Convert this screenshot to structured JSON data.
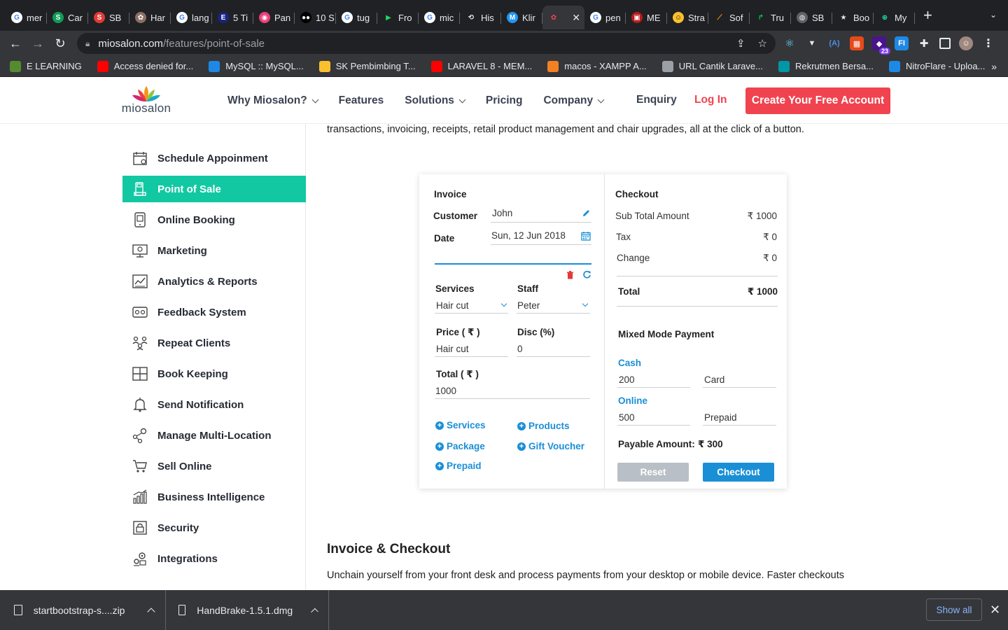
{
  "browser": {
    "tabs": [
      {
        "label": "mer",
        "color": "#ffffff",
        "glyph": "G",
        "fg": "#4285f4"
      },
      {
        "label": "Car",
        "color": "#0f9d58",
        "glyph": "S",
        "fg": "#fff"
      },
      {
        "label": "SB",
        "color": "#e53935",
        "glyph": "S",
        "fg": "#fff"
      },
      {
        "label": "Har",
        "color": "#8d6e63",
        "glyph": "✿",
        "fg": "#fff"
      },
      {
        "label": "lang",
        "color": "#ffffff",
        "glyph": "G",
        "fg": "#4285f4"
      },
      {
        "label": "5 Ti",
        "color": "#1a237e",
        "glyph": "E",
        "fg": "#fff"
      },
      {
        "label": "Pan",
        "color": "#ec407a",
        "glyph": "◉",
        "fg": "#fff"
      },
      {
        "label": "10 S",
        "color": "#000000",
        "glyph": "●●",
        "fg": "#fff"
      },
      {
        "label": "tug",
        "color": "#ffffff",
        "glyph": "G",
        "fg": "#4285f4"
      },
      {
        "label": "Fro",
        "color": "#202124",
        "glyph": "▶",
        "fg": "#1ed760"
      },
      {
        "label": "mic",
        "color": "#ffffff",
        "glyph": "G",
        "fg": "#4285f4"
      },
      {
        "label": "His",
        "color": "#202124",
        "glyph": "⟲",
        "fg": "#e8eaed"
      },
      {
        "label": "Klir",
        "color": "#2196f3",
        "glyph": "M",
        "fg": "#fff"
      },
      {
        "label": "",
        "color": "#35363a",
        "glyph": "✿",
        "fg": "#f0434f",
        "active": true
      },
      {
        "label": "pen",
        "color": "#ffffff",
        "glyph": "G",
        "fg": "#4285f4"
      },
      {
        "label": "ME",
        "color": "#b71c1c",
        "glyph": "▣",
        "fg": "#fff"
      },
      {
        "label": "Stra",
        "color": "#fbc02d",
        "glyph": "☺",
        "fg": "#222"
      },
      {
        "label": "Sof",
        "color": "#202124",
        "glyph": "⟋",
        "fg": "#ff9800"
      },
      {
        "label": "Tru",
        "color": "#202124",
        "glyph": "↱",
        "fg": "#00c853"
      },
      {
        "label": "SB",
        "color": "#5f6368",
        "glyph": "◍",
        "fg": "#e8eaed"
      },
      {
        "label": "Boo",
        "color": "#202124",
        "glyph": "★",
        "fg": "#e8eaed"
      },
      {
        "label": "My",
        "color": "#202124",
        "glyph": "⊕",
        "fg": "#1de9b6"
      }
    ],
    "url_host": "miosalon.com",
    "url_path": "/features/point-of-sale",
    "extension_badge": "23",
    "bookmarks": [
      {
        "label": "E LEARNING",
        "color": "#558b2f"
      },
      {
        "label": "Access denied for...",
        "color": "#ff0000"
      },
      {
        "label": "MySQL :: MySQL...",
        "color": "#1e88e5"
      },
      {
        "label": "SK Pembimbing T...",
        "color": "#fbc02d"
      },
      {
        "label": "LARAVEL 8 - MEM...",
        "color": "#ff0000"
      },
      {
        "label": "macos - XAMPP A...",
        "color": "#f48024"
      },
      {
        "label": "URL Cantik Larave...",
        "color": "#9aa0a6"
      },
      {
        "label": "Rekrutmen Bersa...",
        "color": "#0097a7"
      },
      {
        "label": "NitroFlare - Uploa...",
        "color": "#1e88e5"
      }
    ]
  },
  "header": {
    "logo_text": "miosalon",
    "nav": [
      {
        "label": "Why Miosalon?",
        "dropdown": true
      },
      {
        "label": "Features",
        "dropdown": false
      },
      {
        "label": "Solutions",
        "dropdown": true
      },
      {
        "label": "Pricing",
        "dropdown": false
      },
      {
        "label": "Company",
        "dropdown": true
      }
    ],
    "enquiry": "Enquiry",
    "login": "Log In",
    "cta": "Create Your Free Account"
  },
  "sidebar": {
    "items": [
      {
        "label": "Schedule Appoinment",
        "icon": "calendar-icon"
      },
      {
        "label": "Point of Sale",
        "icon": "pos-terminal-icon",
        "active": true
      },
      {
        "label": "Online Booking",
        "icon": "tablet-icon"
      },
      {
        "label": "Marketing",
        "icon": "monitor-icon"
      },
      {
        "label": "Analytics & Reports",
        "icon": "chart-icon"
      },
      {
        "label": "Feedback System",
        "icon": "feedback-icon"
      },
      {
        "label": "Repeat Clients",
        "icon": "people-icon"
      },
      {
        "label": "Book Keeping",
        "icon": "ledger-icon"
      },
      {
        "label": "Send Notification",
        "icon": "bell-icon"
      },
      {
        "label": "Manage Multi-Location",
        "icon": "location-icon"
      },
      {
        "label": "Sell Online",
        "icon": "cart-icon"
      },
      {
        "label": "Business Intelligence",
        "icon": "bar-growth-icon"
      },
      {
        "label": "Security",
        "icon": "lock-icon"
      },
      {
        "label": "Integrations",
        "icon": "gears-icon"
      }
    ]
  },
  "main": {
    "intro": "transactions, invoicing, receipts, retail product management and chair upgrades, all at the click of a button.",
    "invoice": {
      "title": "Invoice",
      "customer_label": "Customer",
      "customer_value": "John",
      "date_label": "Date",
      "date_value": "Sun, 12 Jun 2018",
      "services_label": "Services",
      "services_value": "Hair cut",
      "staff_label": "Staff",
      "staff_value": "Peter",
      "price_label": "Price ( ₹ )",
      "price_value": "Hair cut",
      "disc_label": "Disc (%)",
      "disc_value": "0",
      "total_label": "Total ( ₹ )",
      "total_value": "1000",
      "add_services": "Services",
      "add_products": "Products",
      "add_package": "Package",
      "add_gift_voucher": "Gift Voucher",
      "add_prepaid": "Prepaid"
    },
    "checkout": {
      "title": "Checkout",
      "subtotal_label": "Sub Total Amount",
      "subtotal_value": "₹ 1000",
      "tax_label": "Tax",
      "tax_value": "₹ 0",
      "change_label": "Change",
      "change_value": "₹ 0",
      "total_label": "Total",
      "total_value": "₹ 1000",
      "mixed_label": "Mixed Mode Payment",
      "cash_label": "Cash",
      "cash_value": "200",
      "card_value": "Card",
      "online_label": "Online",
      "online_value": "500",
      "prepaid_value": "Prepaid",
      "payable_label": "Payable Amount:",
      "payable_value": "₹ 300",
      "reset": "Reset",
      "checkout": "Checkout"
    },
    "section_title": "Invoice & Checkout",
    "section_text": "Unchain yourself from your front desk and process payments from your desktop or mobile device. Faster checkouts"
  },
  "downloads": {
    "items": [
      "startbootstrap-s....zip",
      "HandBrake-1.5.1.dmg"
    ],
    "show_all": "Show all"
  },
  "colors": {
    "accent_teal": "#12c8a3",
    "brand_red": "#f0434f",
    "link_blue": "#1a8fd6"
  }
}
